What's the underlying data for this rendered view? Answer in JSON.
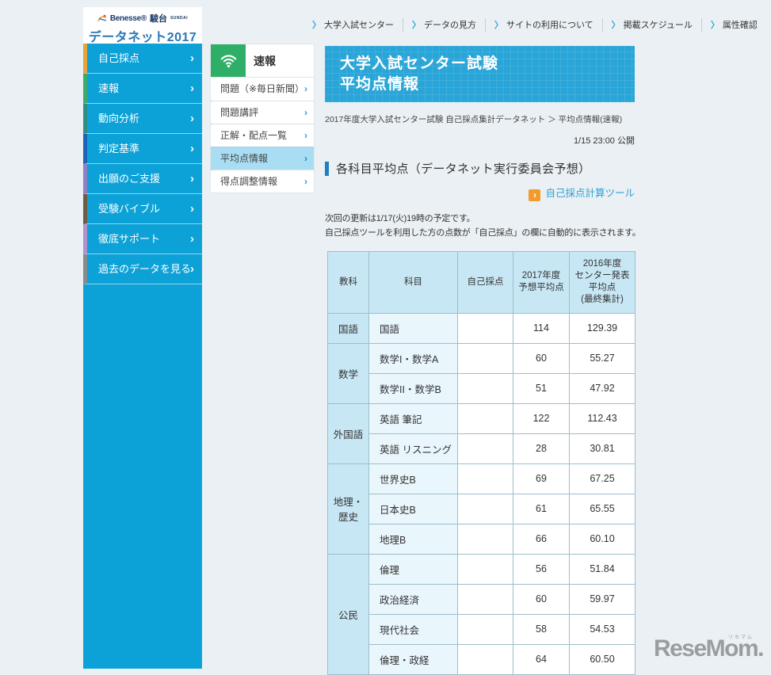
{
  "logo": {
    "benesse": "Benesse®",
    "sundai": "駿台",
    "sundai_sub": "SUNDAI",
    "title": "データネット2017"
  },
  "top_nav": {
    "items": [
      {
        "label": "大学入試センター"
      },
      {
        "label": "データの見方"
      },
      {
        "label": "サイトの利用について"
      },
      {
        "label": "掲載スケジュール"
      },
      {
        "label": "属性確認"
      }
    ]
  },
  "sidebar": {
    "items": [
      {
        "label": "自己採点",
        "accent": "#e5a33c"
      },
      {
        "label": "速報",
        "accent": "#3bab6c"
      },
      {
        "label": "動向分析",
        "accent": "#2f8f85"
      },
      {
        "label": "判定基準",
        "accent": "#1d64b8"
      },
      {
        "label": "出願のご支援",
        "accent": "#8f7fc5"
      },
      {
        "label": "受験バイブル",
        "accent": "#6e5c46"
      },
      {
        "label": "徹底サポート",
        "accent": "#b48fd0"
      },
      {
        "label": "過去のデータを見る",
        "accent": "#868b90"
      }
    ]
  },
  "submenu": {
    "header": "速報",
    "items": [
      {
        "label": "問題（※毎日新聞）",
        "active": false
      },
      {
        "label": "問題講評",
        "active": false
      },
      {
        "label": "正解・配点一覧",
        "active": false
      },
      {
        "label": "平均点情報",
        "active": true
      },
      {
        "label": "得点調整情報",
        "active": false
      }
    ]
  },
  "main": {
    "banner_line1": "大学入試センター試験",
    "banner_line2": "平均点情報",
    "breadcrumb": "2017年度大学入試センター試験 自己採点集計データネット ＞ 平均点情報(速報)",
    "publish_info": "1/15 23:00 公開",
    "section_title": "各科目平均点（データネット実行委員会予想）",
    "tool_link_label": "自己採点計算ツール",
    "note1": "次回の更新は1/17(火)19時の予定です。",
    "note2": "自己採点ツールを利用した方の点数が「自己採点」の欄に自動的に表示されます。"
  },
  "table": {
    "headers": [
      "教科",
      "科目",
      "自己採点",
      "2017年度\n予想平均点",
      "2016年度\nセンター発表\n平均点\n(最終集計)"
    ],
    "groups": [
      {
        "subject": "国語",
        "rows": [
          {
            "name": "国語",
            "self": "",
            "avg2017": "114",
            "avg2016": "129.39"
          }
        ]
      },
      {
        "subject": "数学",
        "rows": [
          {
            "name": "数学I・数学A",
            "self": "",
            "avg2017": "60",
            "avg2016": "55.27"
          },
          {
            "name": "数学II・数学B",
            "self": "",
            "avg2017": "51",
            "avg2016": "47.92"
          }
        ]
      },
      {
        "subject": "外国語",
        "rows": [
          {
            "name": "英語 筆記",
            "self": "",
            "avg2017": "122",
            "avg2016": "112.43"
          },
          {
            "name": "英語 リスニング",
            "self": "",
            "avg2017": "28",
            "avg2016": "30.81"
          }
        ]
      },
      {
        "subject": "地理・歴史",
        "rows": [
          {
            "name": "世界史B",
            "self": "",
            "avg2017": "69",
            "avg2016": "67.25"
          },
          {
            "name": "日本史B",
            "self": "",
            "avg2017": "61",
            "avg2016": "65.55"
          },
          {
            "name": "地理B",
            "self": "",
            "avg2017": "66",
            "avg2016": "60.10"
          }
        ]
      },
      {
        "subject": "公民",
        "rows": [
          {
            "name": "倫理",
            "self": "",
            "avg2017": "56",
            "avg2016": "51.84"
          },
          {
            "name": "政治経済",
            "self": "",
            "avg2017": "60",
            "avg2016": "59.97"
          },
          {
            "name": "現代社会",
            "self": "",
            "avg2017": "58",
            "avg2016": "54.53"
          },
          {
            "name": "倫理・政経",
            "self": "",
            "avg2017": "64",
            "avg2016": "60.50"
          }
        ]
      }
    ]
  },
  "icons": {
    "chevron": "›",
    "nav_chevron": "〉"
  },
  "colors": {
    "sidebar_blue": "#0ca2d8",
    "banner_blue": "#29a5d8",
    "active_item_blue": "#a9ddf3",
    "value_red": "#cc4545",
    "link_blue": "#2e9fd4",
    "green": "#2fae68",
    "orange": "#f29b2d"
  },
  "watermark": {
    "text": "ReseMom.",
    "ruby": "リセマム"
  }
}
